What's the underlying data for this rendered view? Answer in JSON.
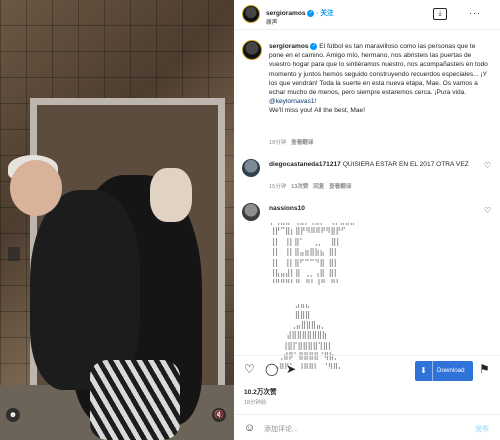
{
  "header": {
    "username": "sergioramos",
    "follow_label": "关注",
    "location": "原声"
  },
  "caption": {
    "username": "sergioramos",
    "text": "El fútbol es tan maravilloso como las personas que te pone en el camino. Amigo mío, hermano, nos abristeis las puertas de vuestro hogar para que lo sintiéramos nuestro, nos acompañasteis en todo momento y juntos hemos seguido construyendo recuerdos especiales... ¡Y los que vendrán! Toda la suerte en esta nueva etapa, Mae. Os vamos a echar mucho de menos, pero siempre estaremos cerca. ¡Pura vida.",
    "mention": "@keylornavas1!",
    "english": "We'll miss you! All the best, Mae!",
    "meta_time": "18分钟",
    "meta_translate": "查看翻译"
  },
  "comments": [
    {
      "username": "diegocastaneda171217",
      "text": "QUISIERA ESTAR EN EL 2017 OTRA VEZ",
      "time": "15分钟",
      "likes": "13次赞",
      "reply": "回复",
      "translate": "查看翻译"
    },
    {
      "username": "nassions10",
      "ascii": "⡀⢀⣀⣀ ⢀⣀⡀⢀⣀⡀⠀⢀⡀⣀⣀⣀⠀\n⢸⡟⠉⣿⡆⣿⡟⠻⠿⠿⠟⠻⣿⡟⠋\n⢸⡇ ⢸⡇⣿⠁  ⢀⡀  ⣿⡇\n⢸⡇ ⢸⡇⣿⣤⣶⣿⣷⣦ ⣿⡇\n⢸⡇ ⢸⡇⣿⠋⠉⠉⠙⣿ ⣿⡇\n⢸⣧⣤⣼⡇⣿ ⢀⡀⢠⣿ ⣿⡇\n⠘⠛⠛⠛⠃⠛⠀⠛⠃⠸⠛⠀⠛⠃\n\n      ⣠⣤⣄\n      ⣿⣿⣿\n     ⢀⣤⣿⣿⣿⣤⡀\n    ⣼⣿⣿⣿⣿⣿⣿⣷\n   ⢸⣿⡏⣿⣿⣿⣿⢹⣿⡇\n  ⢀⣾⡿⠁⣿⣿⣿⣿⠈⢿⣷⡀\n ⠠⠿⠟⠁ ⠸⠿⠿⠇ ⠈⠻⠿⠄"
    }
  ],
  "actions": {
    "download_label": "Download",
    "likes": "10.2万次赞",
    "time": "18分钟前"
  },
  "footer": {
    "comment_placeholder": "添加评论...",
    "post_label": "发布"
  }
}
